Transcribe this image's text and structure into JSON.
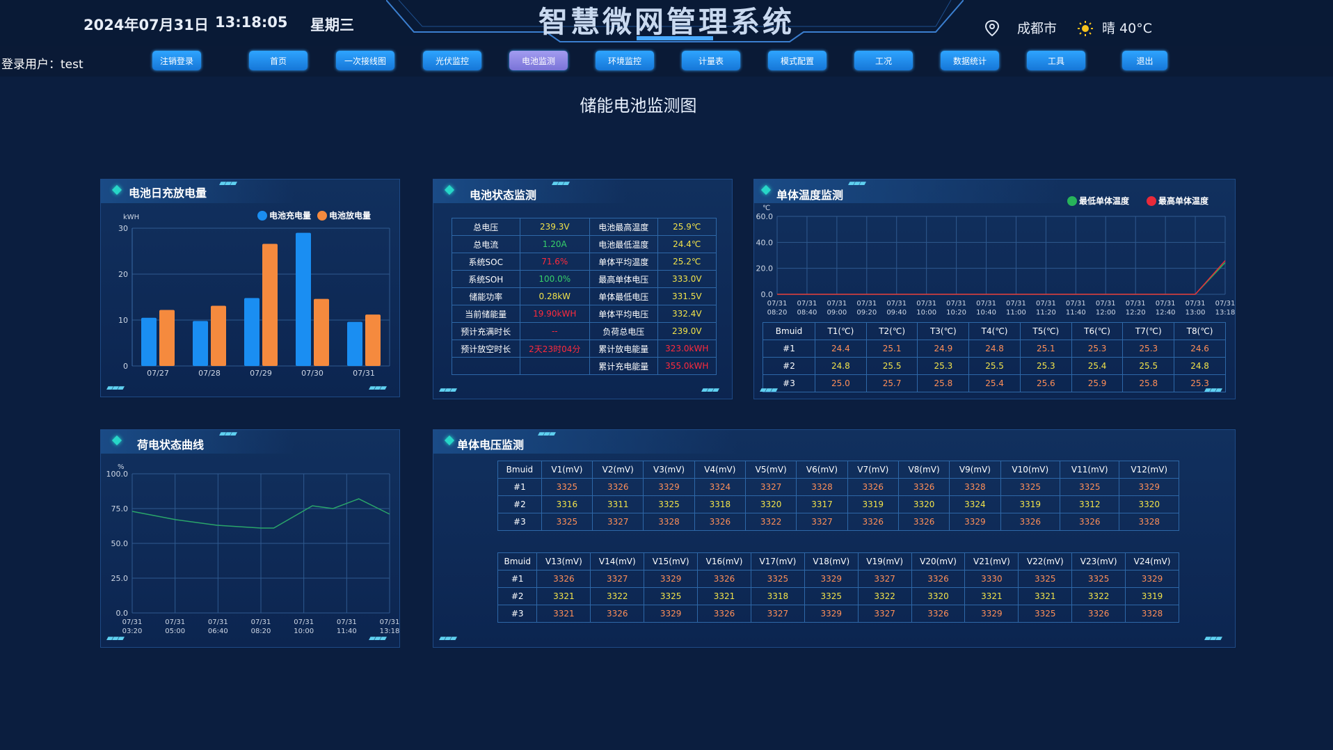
{
  "header": {
    "date": "2024年07月31日",
    "time": "13:18:05",
    "weekday": "星期三",
    "title": "智慧微网管理系统",
    "city": "成都市",
    "weather": "晴 40°C",
    "location_icon": "location-pin-icon",
    "weather_icon": "sun-icon"
  },
  "nav": {
    "user_label": "登录用户：test",
    "buttons": [
      "注销登录",
      "首页",
      "一次接线图",
      "光伏监控",
      "电池监测",
      "环境监控",
      "计量表",
      "模式配置",
      "工况",
      "数据统计",
      "工具",
      "退出"
    ],
    "active": "电池监测"
  },
  "page_title": "储能电池监测图",
  "panels": {
    "charge": {
      "title": "电池日充放电量",
      "legend": [
        "电池充电量",
        "电池放电量"
      ],
      "unit": "kWH",
      "colors": {
        "charge": "#1a8ef2",
        "discharge": "#f58a3e"
      }
    },
    "status": {
      "title": "电池状态监测",
      "rows": [
        {
          "l1": "总电压",
          "v1": "239.3V",
          "c1": "yel",
          "l2": "电池最高温度",
          "v2": "25.9℃",
          "c2": "yel"
        },
        {
          "l1": "总电流",
          "v1": "1.20A",
          "c1": "grn",
          "l2": "电池最低温度",
          "v2": "24.4℃",
          "c2": "yel"
        },
        {
          "l1": "系统SOC",
          "v1": "71.6%",
          "c1": "red",
          "l2": "单体平均温度",
          "v2": "25.2℃",
          "c2": "yel"
        },
        {
          "l1": "系统SOH",
          "v1": "100.0%",
          "c1": "grn",
          "l2": "最高单体电压",
          "v2": "333.0V",
          "c2": "yel"
        },
        {
          "l1": "储能功率",
          "v1": "0.28kW",
          "c1": "yel",
          "l2": "单体最低电压",
          "v2": "331.5V",
          "c2": "yel"
        },
        {
          "l1": "当前储能量",
          "v1": "19.90kWH",
          "c1": "red",
          "l2": "单体平均电压",
          "v2": "332.4V",
          "c2": "yel"
        },
        {
          "l1": "预计充满时长",
          "v1": "--",
          "c1": "red",
          "l2": "负荷总电压",
          "v2": "239.0V",
          "c2": "yel"
        },
        {
          "l1": "预计放空时长",
          "v1": "2天23时04分",
          "c1": "red",
          "l2": "累计放电能量",
          "v2": "323.0kWH",
          "c2": "red"
        },
        {
          "l1": "",
          "v1": "",
          "c1": "red",
          "l2": "累计充电能量",
          "v2": "355.0kWH",
          "c2": "red"
        }
      ]
    },
    "temp": {
      "title": "单体温度监测",
      "legend": [
        "最低单体温度",
        "最高单体温度"
      ],
      "unit": "℃",
      "colors": {
        "min": "#27b35a",
        "max": "#e82a3a"
      },
      "headers": [
        "Bmuid",
        "T1(℃)",
        "T2(℃)",
        "T3(℃)",
        "T4(℃)",
        "T5(℃)",
        "T6(℃)",
        "T7(℃)",
        "T8(℃)"
      ],
      "rows": [
        [
          "#1",
          "24.4",
          "25.1",
          "24.9",
          "24.8",
          "25.1",
          "25.3",
          "25.3",
          "24.6"
        ],
        [
          "#2",
          "24.8",
          "25.5",
          "25.3",
          "25.5",
          "25.3",
          "25.4",
          "25.5",
          "24.8"
        ],
        [
          "#3",
          "25.0",
          "25.7",
          "25.8",
          "25.4",
          "25.6",
          "25.9",
          "25.8",
          "25.3"
        ]
      ]
    },
    "soc": {
      "title": "荷电状态曲线",
      "unit": "%",
      "color": "#2aa66a"
    },
    "voltage": {
      "title": "单体电压监测",
      "table1": {
        "headers": [
          "Bmuid",
          "V1(mV)",
          "V2(mV)",
          "V3(mV)",
          "V4(mV)",
          "V5(mV)",
          "V6(mV)",
          "V7(mV)",
          "V8(mV)",
          "V9(mV)",
          "V10(mV)",
          "V11(mV)",
          "V12(mV)"
        ],
        "rows": [
          [
            "#1",
            "3325",
            "3326",
            "3329",
            "3324",
            "3327",
            "3328",
            "3326",
            "3326",
            "3328",
            "3325",
            "3325",
            "3329"
          ],
          [
            "#2",
            "3316",
            "3311",
            "3325",
            "3318",
            "3320",
            "3317",
            "3319",
            "3320",
            "3324",
            "3319",
            "3312",
            "3320"
          ],
          [
            "#3",
            "3325",
            "3327",
            "3328",
            "3326",
            "3322",
            "3327",
            "3326",
            "3326",
            "3329",
            "3326",
            "3326",
            "3328"
          ]
        ]
      },
      "table2": {
        "headers": [
          "Bmuid",
          "V13(mV)",
          "V14(mV)",
          "V15(mV)",
          "V16(mV)",
          "V17(mV)",
          "V18(mV)",
          "V19(mV)",
          "V20(mV)",
          "V21(mV)",
          "V22(mV)",
          "V23(mV)",
          "V24(mV)"
        ],
        "rows": [
          [
            "#1",
            "3326",
            "3327",
            "3329",
            "3326",
            "3325",
            "3329",
            "3327",
            "3326",
            "3330",
            "3325",
            "3325",
            "3329"
          ],
          [
            "#2",
            "3321",
            "3322",
            "3325",
            "3321",
            "3318",
            "3325",
            "3322",
            "3320",
            "3321",
            "3321",
            "3322",
            "3319"
          ],
          [
            "#3",
            "3321",
            "3326",
            "3329",
            "3326",
            "3327",
            "3329",
            "3327",
            "3326",
            "3329",
            "3325",
            "3326",
            "3328"
          ]
        ]
      }
    }
  },
  "chart_data": [
    {
      "type": "bar",
      "title": "电池日充放电量",
      "ylabel": "kWH",
      "categories": [
        "07/27",
        "07/28",
        "07/29",
        "07/30",
        "07/31"
      ],
      "series": [
        {
          "name": "电池充电量",
          "values": [
            10.5,
            9.8,
            14.8,
            29,
            9.6
          ]
        },
        {
          "name": "电池放电量",
          "values": [
            12.2,
            13.1,
            26.6,
            14.6,
            11.2
          ]
        }
      ],
      "ylim": [
        0,
        30
      ],
      "yticks": [
        0,
        10,
        20,
        30
      ],
      "legend": "top-right",
      "grid": true
    },
    {
      "type": "line",
      "title": "单体温度监测",
      "ylabel": "℃",
      "x": [
        "07/31 08:20",
        "07/31 08:40",
        "07/31 09:00",
        "07/31 09:20",
        "07/31 09:40",
        "07/31 10:00",
        "07/31 10:20",
        "07/31 10:40",
        "07/31 11:00",
        "07/31 11:20",
        "07/31 11:40",
        "07/31 12:00",
        "07/31 12:20",
        "07/31 12:40",
        "07/31 13:00",
        "07/31 13:18"
      ],
      "series": [
        {
          "name": "最低单体温度",
          "values": [
            0,
            0,
            0,
            0,
            0,
            0,
            0,
            0,
            0,
            0,
            0,
            0,
            0,
            0,
            0,
            24.4
          ]
        },
        {
          "name": "最高单体温度",
          "values": [
            0,
            0,
            0,
            0,
            0,
            0,
            0,
            0,
            0,
            0,
            0,
            0,
            0,
            0,
            0,
            25.9
          ]
        }
      ],
      "ylim": [
        0,
        60
      ],
      "yticks": [
        0,
        20,
        40,
        60
      ],
      "legend": "top-right",
      "grid": true
    },
    {
      "type": "line",
      "title": "荷电状态曲线",
      "ylabel": "%",
      "x": [
        "07/31 03:20",
        "07/31 05:00",
        "07/31 06:40",
        "07/31 08:20",
        "07/31 10:00",
        "07/31 11:40",
        "07/31 13:18"
      ],
      "series": [
        {
          "name": "",
          "values": [
            73,
            67,
            63,
            61,
            61,
            77,
            75,
            82,
            71
          ]
        }
      ],
      "x_fraction": [
        0,
        0.17,
        0.33,
        0.5,
        0.55,
        0.7,
        0.78,
        0.88,
        1
      ],
      "ylim": [
        0,
        100
      ],
      "yticks": [
        0,
        25,
        50,
        75,
        100
      ],
      "grid": true
    }
  ]
}
